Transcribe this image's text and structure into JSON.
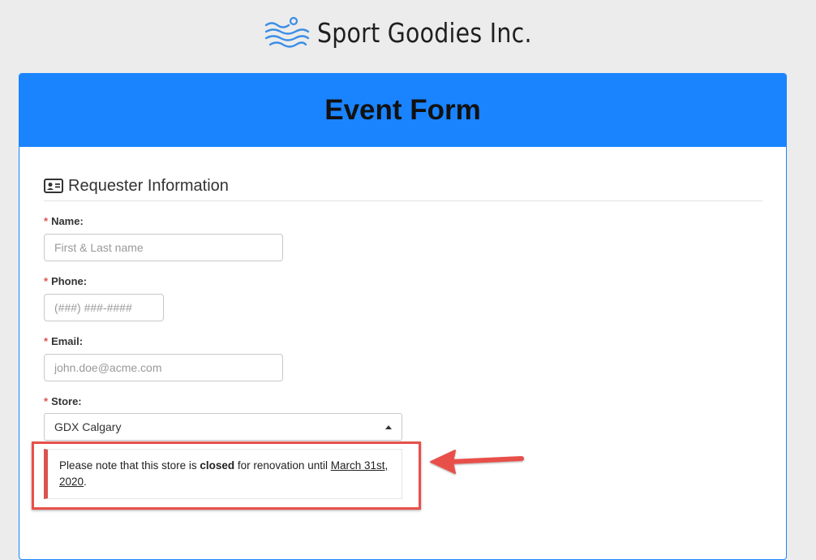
{
  "brand": {
    "name": "Sport Goodies Inc.",
    "logo_icon": "waves-swimmer-icon",
    "logo_color": "#3a8ee6"
  },
  "form": {
    "title": "Event Form",
    "header_color": "#1a84ff",
    "section": {
      "icon": "id-card-icon",
      "label": "Requester Information"
    },
    "fields": {
      "name": {
        "required_mark": "*",
        "label": "Name:",
        "placeholder": "First & Last name",
        "value": ""
      },
      "phone": {
        "required_mark": "*",
        "label": "Phone:",
        "placeholder": "(###) ###-####",
        "value": ""
      },
      "email": {
        "required_mark": "*",
        "label": "Email:",
        "placeholder": "john.doe@acme.com",
        "value": ""
      },
      "store": {
        "required_mark": "*",
        "label": "Store:",
        "selected": "GDX Calgary",
        "icon": "caret-up-icon"
      }
    },
    "notice": {
      "text_before": "Please note that this store is ",
      "bold": "closed",
      "text_middle": " for renovation until ",
      "underlined": "March 31st, 2020",
      "text_after": ".",
      "accent_color": "#d9534f"
    }
  },
  "annotation": {
    "box_color": "#e8504a",
    "arrow_icon": "arrow-left-icon"
  }
}
